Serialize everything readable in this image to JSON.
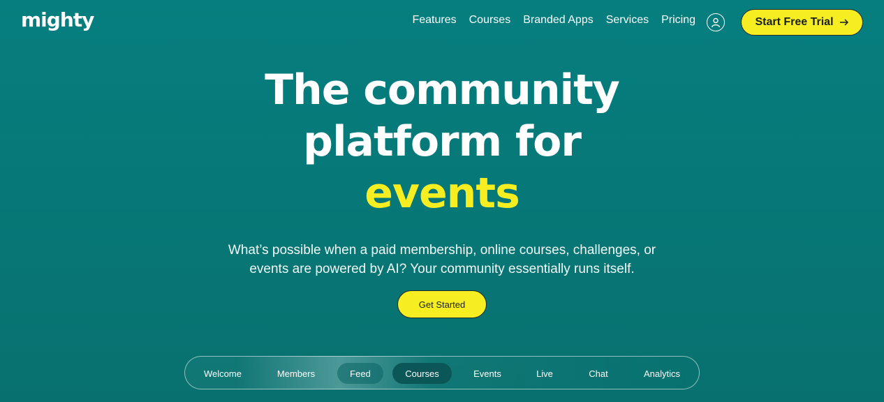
{
  "header": {
    "logo": "mighty",
    "nav": [
      "Features",
      "Courses",
      "Branded Apps",
      "Services",
      "Pricing"
    ],
    "user_icon": "user-circle-icon",
    "cta_label": "Start Free Trial",
    "cta_icon": "arrow-right-icon"
  },
  "hero": {
    "title_line1": "The community",
    "title_line2": "platform for",
    "title_accent": "events",
    "subtitle_line1": "What’s possible when a paid membership, online courses, challenges, or",
    "subtitle_line2": "events are powered by AI? Your community essentially runs itself.",
    "button_label": "Get Started"
  },
  "tabs": [
    "Welcome",
    "Members",
    "Feed",
    "Courses",
    "Events",
    "Live",
    "Chat",
    "Analytics"
  ],
  "colors": {
    "background": "#077a7a",
    "accent": "#f6ee20",
    "selected_tab": "#0b5758"
  }
}
